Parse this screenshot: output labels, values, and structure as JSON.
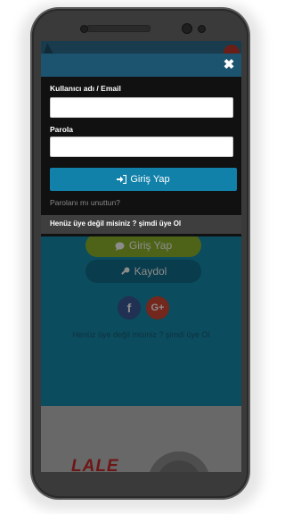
{
  "background": {
    "login_button_label": "Giriş Yap",
    "register_button_label": "Kaydol",
    "facebook_glyph": "f",
    "google_glyph": "G+",
    "signup_prompt": "Henüz üye değil misiniz ? şimdi üye Ol",
    "footer_logo_text": "LALE"
  },
  "modal": {
    "close_glyph": "✖",
    "username_label": "Kullanıcı adı / Email",
    "username_value": "",
    "password_label": "Parola",
    "password_value": "",
    "login_button_label": "Giriş Yap",
    "forgot_password_link": "Parolanı mı unuttun?",
    "signup_prompt": "Henüz üye değil misiniz ? şimdi üye Ol"
  },
  "colors": {
    "modal_header": "#1c5470",
    "modal_body": "#111111",
    "login_button": "#1281a9",
    "signup_bar": "#3e3e3e",
    "bg_login_button": "#8fb42c",
    "bg_register_button": "#126e8b",
    "facebook": "#3b5998",
    "google": "#d34836",
    "logo_red": "#c62828"
  },
  "icons": {
    "login": "sign-in-icon",
    "register": "key-icon",
    "bg_login": "chat-bubble-icon",
    "close": "close-icon"
  }
}
